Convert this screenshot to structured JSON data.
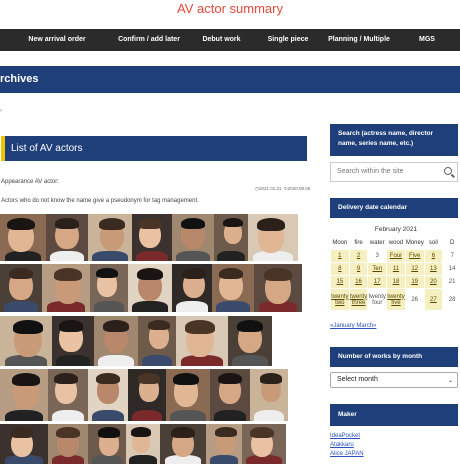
{
  "site": {
    "title": "AV actor summary"
  },
  "nav": {
    "items": [
      "New arrival order",
      "Confirm / add later",
      "Debut work",
      "Single piece",
      "Planning / Multiple",
      "MGS"
    ]
  },
  "archives": {
    "title": "rchives"
  },
  "main": {
    "list_title": "List of AV actors",
    "label": "Appearance AV actor:",
    "date_published": "2021.01.31",
    "date_updated": "2020.09.06",
    "note": "Actors who do not know the name give a pseudonym for tag management."
  },
  "sidebar": {
    "search_heading": "Search (actress name, director name, series name, etc.)",
    "search_placeholder": "Search within the site",
    "calendar_heading": "Delivery date calendar",
    "calendar_caption": "February 2021",
    "calendar_days": [
      "Moon",
      "fire",
      "water",
      "wood",
      "Money",
      "soil",
      "D"
    ],
    "calendar_rows": [
      [
        "1",
        "2",
        "3",
        "Four",
        "Five",
        "6",
        "7"
      ],
      [
        "8",
        "9",
        "Ten",
        "11",
        "12",
        "13",
        "14"
      ],
      [
        "15",
        "16",
        "17",
        "18",
        "19",
        "20",
        "21"
      ],
      [
        "twenty two",
        "twenty three",
        "twenty four",
        "twenty five",
        "26",
        "27",
        "28"
      ]
    ],
    "prev_month": "«January",
    "next_month": "March»",
    "works_heading": "Number of works by month",
    "select_value": "Select month",
    "maker_heading": "Maker",
    "makers": [
      "IdeaPocket",
      "Atakkaru",
      "Alice JAPAN"
    ]
  },
  "colors": {
    "accent": "#1e3f7a",
    "title_red": "#e8473a",
    "nav_bg": "#2b2b2b",
    "calendar_cell": "#f6efc0",
    "highlight_bar": "#f2c300"
  }
}
